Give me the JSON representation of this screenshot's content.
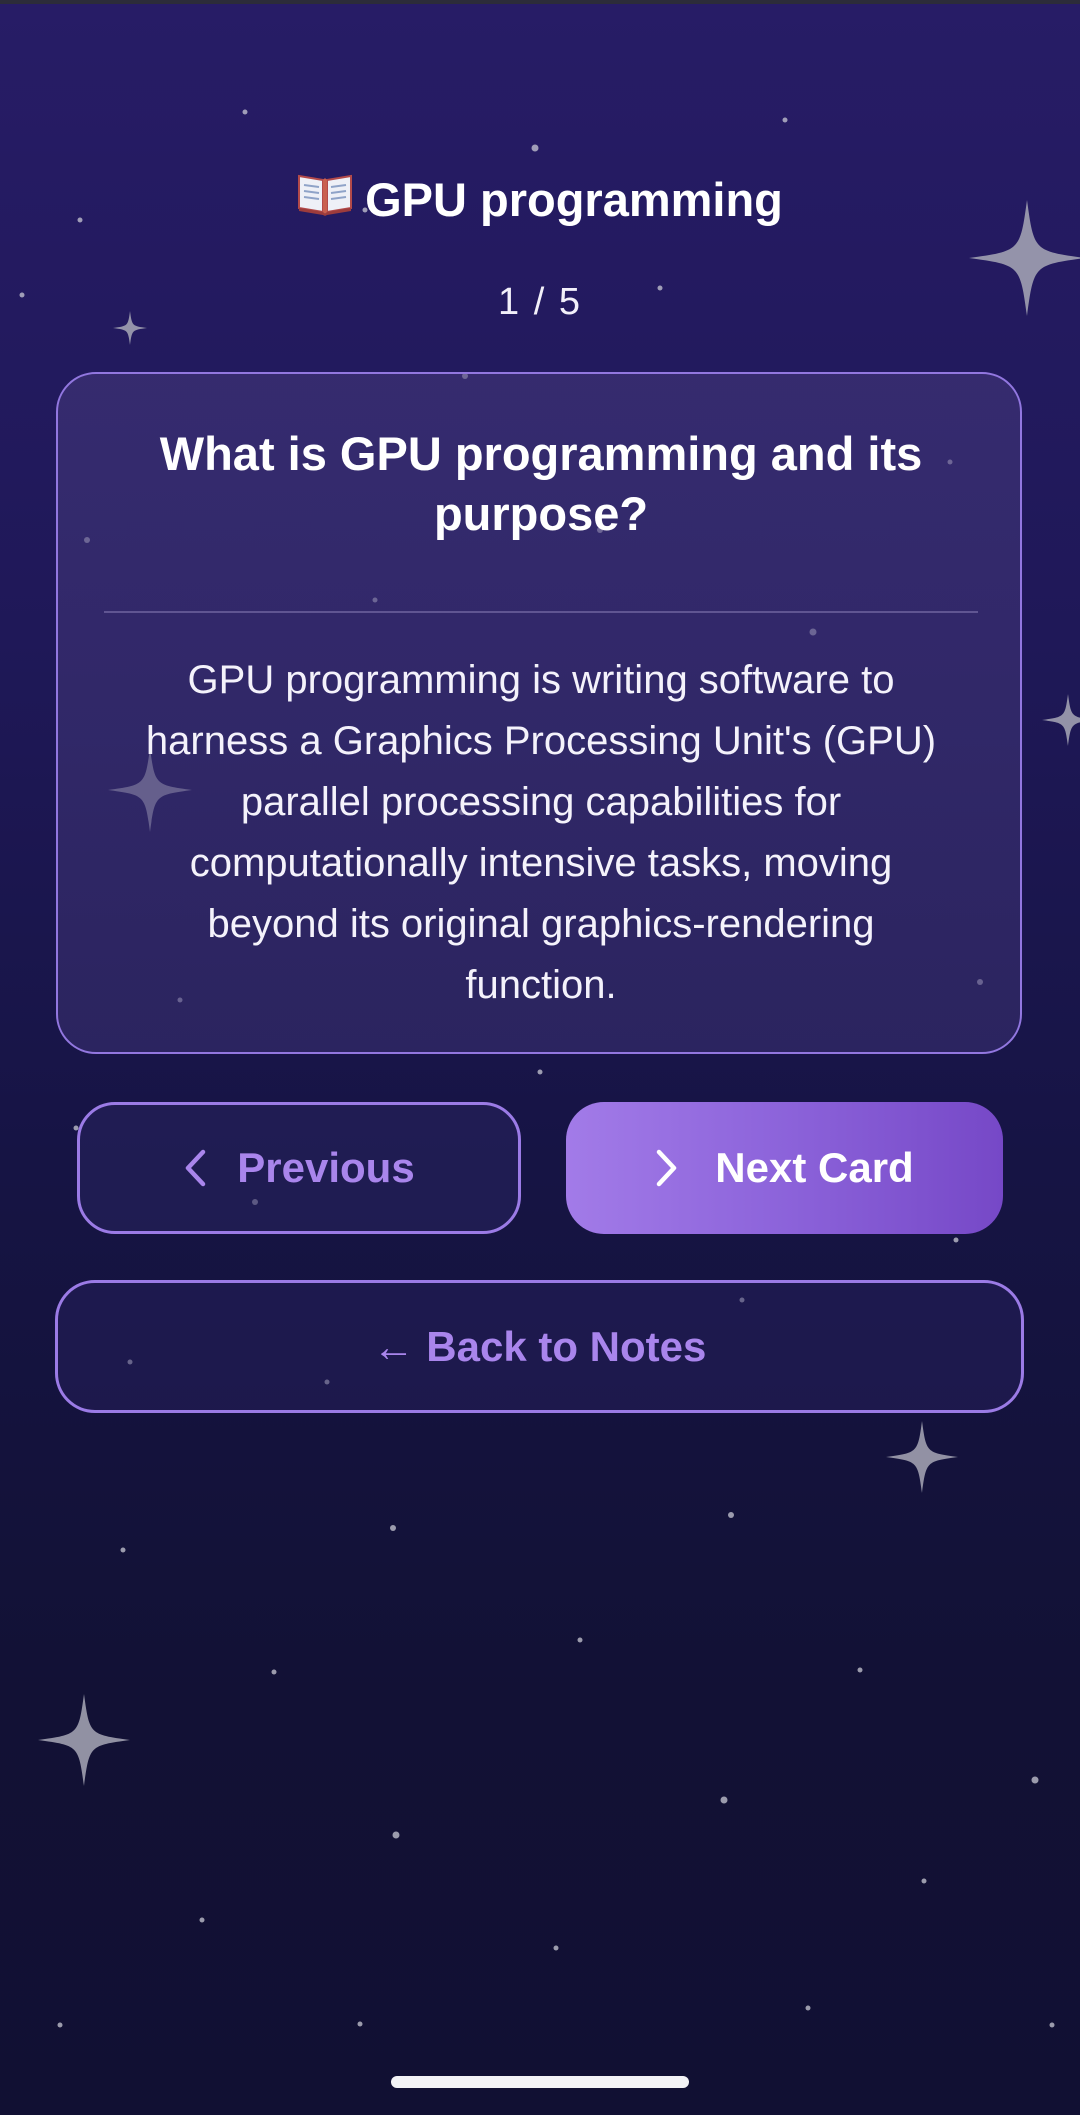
{
  "header": {
    "icon": "open-book-icon",
    "title": "GPU programming",
    "counter": "1 / 5"
  },
  "card": {
    "question": "What is GPU programming and its purpose?",
    "answer": "GPU programming is writing software to harness a Graphics Processing Unit's (GPU) parallel processing capabilities for computationally intensive tasks, moving beyond its original graphics-rendering function."
  },
  "navigation": {
    "previous_label": "Previous",
    "next_label": "Next Card",
    "back_label": "← Back to Notes",
    "previous_icon": "chevron-left-icon",
    "next_icon": "chevron-right-icon"
  },
  "colors": {
    "accent": "#9b7be6",
    "accent_text": "#a985ec",
    "background_top": "#271c66",
    "background_bottom": "#111033"
  }
}
